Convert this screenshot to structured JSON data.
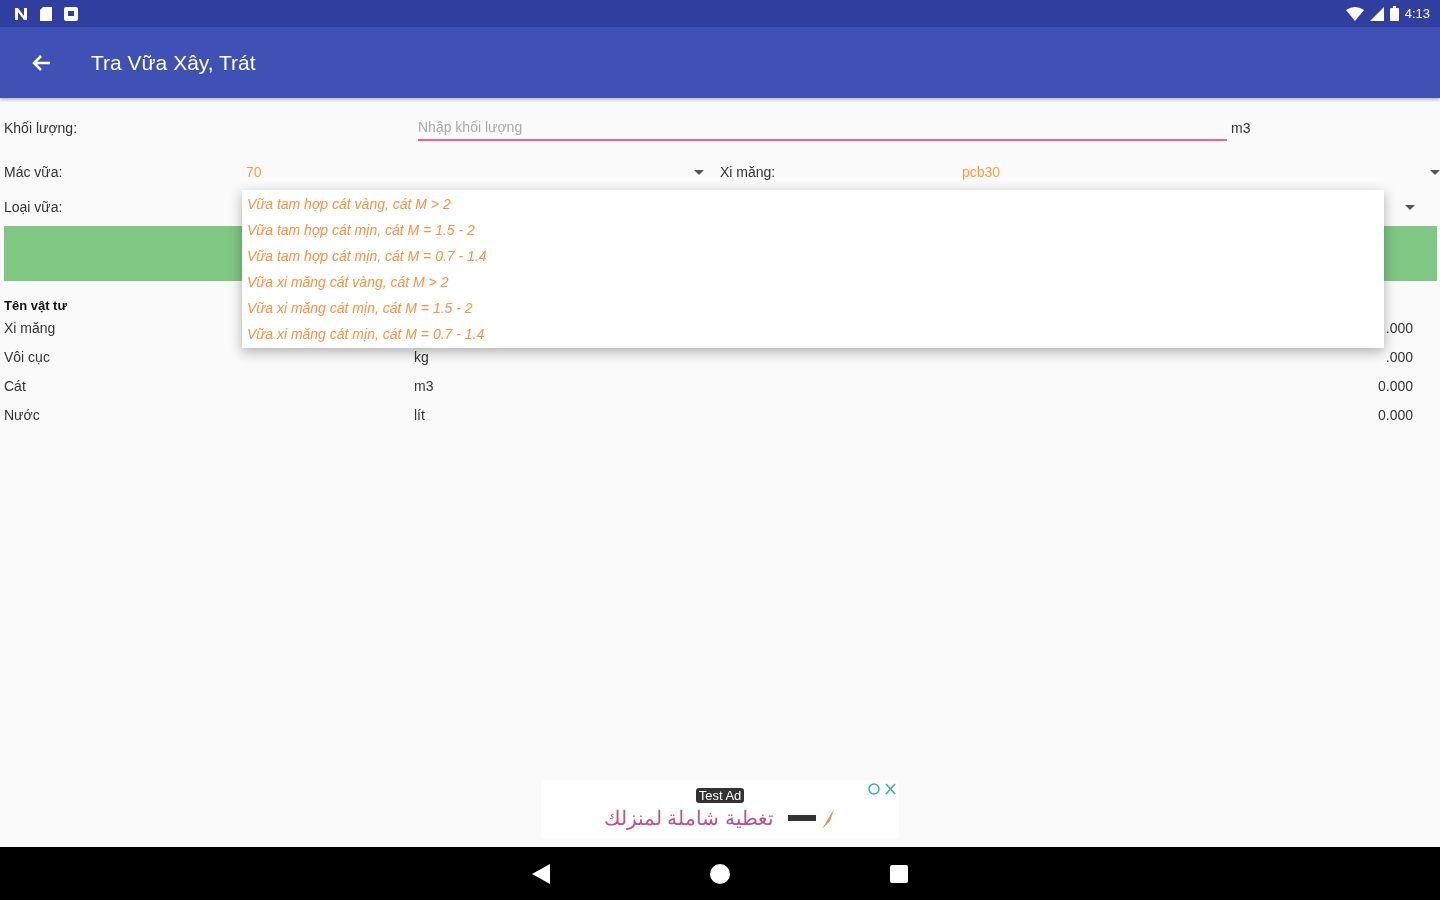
{
  "status_bar": {
    "time": "4:13"
  },
  "app_bar": {
    "title": "Tra Vữa Xây, Trát"
  },
  "form": {
    "volume": {
      "label": "Khối lượng:",
      "placeholder": "Nhập khối lượng",
      "unit": "m3"
    },
    "grade": {
      "label": "Mác vữa:",
      "value": "70"
    },
    "cement": {
      "label": "Xi măng:",
      "value": "pcb30"
    },
    "mortar_type": {
      "label": "Loại vữa:",
      "expanded": true,
      "options": [
        {
          "label": "Vữa tam hợp cát vàng, cát M > 2"
        },
        {
          "label": "Vữa tam hợp cát mịn, cát M = 1.5 - 2"
        },
        {
          "label": "Vữa tam hợp cát mịn, cát M = 0.7 - 1.4"
        },
        {
          "label": "Vữa xi măng cát vàng, cát M > 2"
        },
        {
          "label": "Vữa xi măng cát mịn, cát M = 1.5 - 2"
        },
        {
          "label": "Vữa xi măng cát mịn, cát M = 0.7 - 1.4"
        }
      ]
    }
  },
  "table": {
    "header": "Tên vật tư",
    "rows": [
      {
        "name": "Xi măng",
        "value": ".000"
      },
      {
        "name": "Vôi cục",
        "unit": "kg",
        "value": ".000"
      },
      {
        "name": "Cát",
        "unit": "m3",
        "value": "0.000"
      },
      {
        "name": "Nước",
        "unit": "lít",
        "value": "0.000"
      }
    ]
  },
  "ad": {
    "badge": "Test Ad",
    "text": "تغطية شاملة لمنزلك"
  }
}
